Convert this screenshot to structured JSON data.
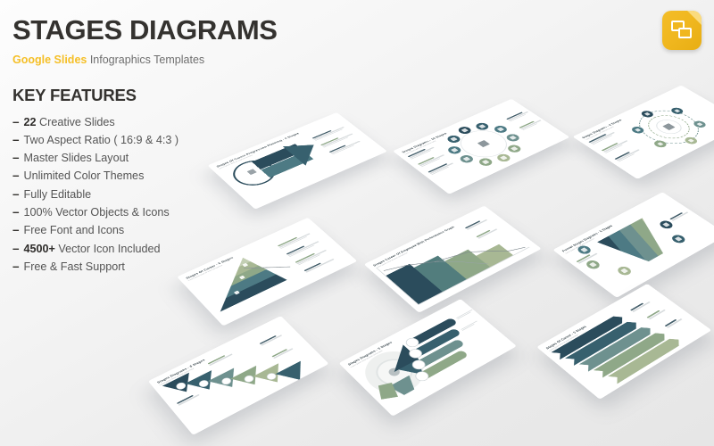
{
  "header": {
    "title": "STAGES DIAGRAMS",
    "subtitle_brand": "Google Slides",
    "subtitle_rest": " Infographics Templates",
    "brand_color": "#f5bf26",
    "title_color": "#34322f"
  },
  "features": {
    "heading": "KEY FEATURES",
    "bullet_char": "–",
    "items": [
      {
        "strong": "22",
        "text": "Creative Slides"
      },
      {
        "strong": "",
        "text": "Two Aspect Ratio ( 16:9 & 4:3 )"
      },
      {
        "strong": "",
        "text": "Master Slides Layout"
      },
      {
        "strong": "",
        "text": "Unlimited Color Themes"
      },
      {
        "strong": "",
        "text": "Fully Editable"
      },
      {
        "strong": "",
        "text": "100% Vector Objects & Icons"
      },
      {
        "strong": "",
        "text": "Free Font and Icons"
      },
      {
        "strong": "4500+",
        "text": "Vector Icon Included"
      },
      {
        "strong": "",
        "text": "Free & Fast Support"
      }
    ]
  },
  "logo": {
    "name": "google-slides-logo",
    "badge_color": "#f0b71f"
  },
  "palette": {
    "dark_navy": "#2b4c5c",
    "deep_teal": "#37606e",
    "mid_teal": "#4d7a84",
    "slate_teal": "#6e918f",
    "sage": "#8fa888",
    "olive": "#a8b894",
    "pale_sage": "#c3cfb4",
    "background": "#eeeeee",
    "slide_white": "#ffffff"
  },
  "slides": [
    {
      "id": "career-progression-4",
      "title": "Stages Of Career Progression Planning - 4 Stages",
      "subtitle": "Lorem ipsum dolor sit amet consectetur",
      "diagram": "circle-arrow"
    },
    {
      "id": "stages-10",
      "title": "Stages Diagrams - 10 Stages",
      "subtitle": "Lorem ipsum dolor sit amet consectetur",
      "diagram": "node-ring"
    },
    {
      "id": "stages-6-circular",
      "title": "Stages Diagrams - 6 Stages",
      "subtitle": "Lorem ipsum dolor sit amet consectetur",
      "diagram": "dashed-orbit"
    },
    {
      "id": "career-5-pyramid",
      "title": "Stages Of Career - 5 Stages",
      "subtitle": "Lorem ipsum dolor sit amet consectetur",
      "diagram": "pyramid"
    },
    {
      "id": "career-performance-graph",
      "title": "Stages Career Of Employee With Performance Graph",
      "subtitle": "Lorem ipsum dolor sit amet consectetur",
      "diagram": "matrix-graph"
    },
    {
      "id": "funnel-5",
      "title": "Funnel Stages Diagrams - 5 Stages",
      "subtitle": "Lorem ipsum dolor sit amet consectetur",
      "diagram": "funnel"
    },
    {
      "id": "career-5-chevrons",
      "title": "Stages Of Career - 5 Stages",
      "subtitle": "Lorem ipsum dolor sit amet consectetur",
      "diagram": "chevron-stack"
    },
    {
      "id": "stages-6-arrows",
      "title": "Stages Diagrams - 6 Stages",
      "subtitle": "Lorem ipsum dolor sit amet consectetur",
      "diagram": "cascade-arrows"
    },
    {
      "id": "stages-5-radial",
      "title": "Stages Diagrams - 5 Stages",
      "subtitle": "Lorem ipsum dolor sit amet consectetur",
      "diagram": "radial-pills"
    }
  ]
}
